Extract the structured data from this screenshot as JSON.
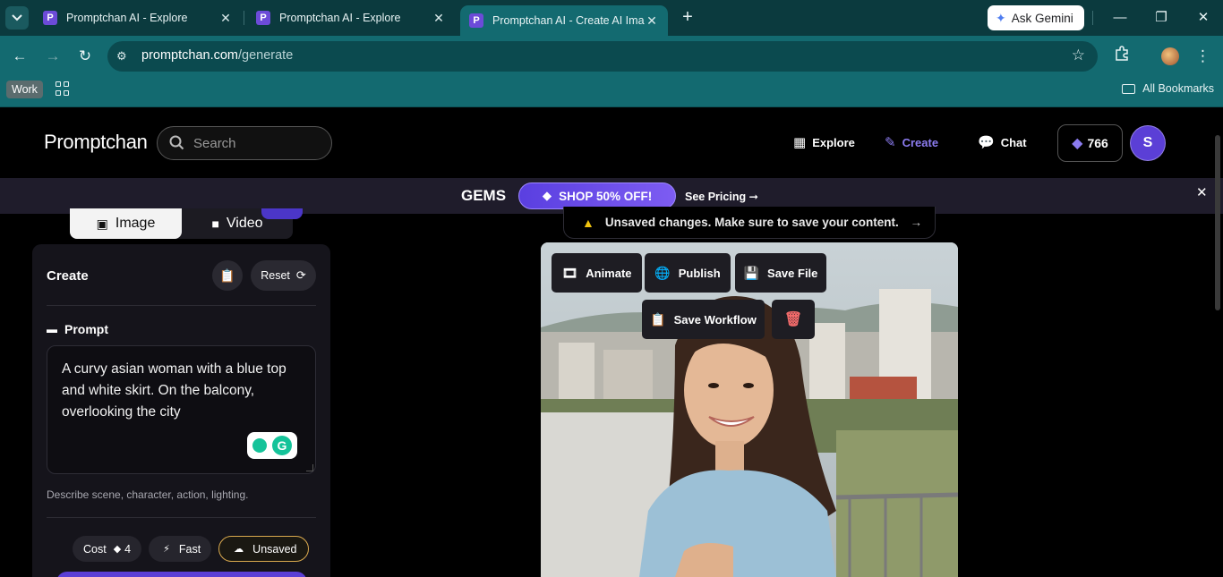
{
  "browser": {
    "tabs": [
      {
        "title": "Promptchan AI - Explore",
        "favicon": "P"
      },
      {
        "title": "Promptchan AI - Explore",
        "favicon": "P"
      },
      {
        "title": "Promptchan AI - Create AI Imag",
        "favicon": "P"
      }
    ],
    "new_tab": "+",
    "ask_gemini": "Ask Gemini",
    "url_domain": "promptchan.com",
    "url_path": "/generate",
    "bookmark_folder": "Work",
    "all_bookmarks": "All Bookmarks"
  },
  "site": {
    "logo": "Promptchan",
    "search_placeholder": "Search",
    "nav": {
      "explore": "Explore",
      "create": "Create",
      "chat": "Chat"
    },
    "gems_count": "766",
    "avatar_letter": "S"
  },
  "promo": {
    "label": "GEMS",
    "shop": "SHOP 50% OFF!",
    "pricing": "See Pricing ➞",
    "close": "✕"
  },
  "panel": {
    "tab_image": "Image",
    "tab_video": "Video",
    "title": "Create",
    "reset": "Reset",
    "prompt_label": "Prompt",
    "prompt_text": "A curvy asian woman with a blue top and white skirt. On the balcony, overlooking the city",
    "hint": "Describe scene, character, action, lighting.",
    "cost_label": "Cost",
    "cost_value": "4",
    "speed": "Fast",
    "status": "Unsaved"
  },
  "result": {
    "banner": "Unsaved changes. Make sure to save your content.",
    "banner_arrow": "→",
    "actions": {
      "animate": "Animate",
      "publish": "Publish",
      "save_file": "Save File",
      "save_workflow": "Save Workflow"
    }
  },
  "colors": {
    "accent": "#8c7cf0",
    "brand_purple": "#5b3fd6",
    "chrome_teal": "#136a70",
    "warning": "#f1c40f",
    "delete_red": "#f26b6b"
  }
}
